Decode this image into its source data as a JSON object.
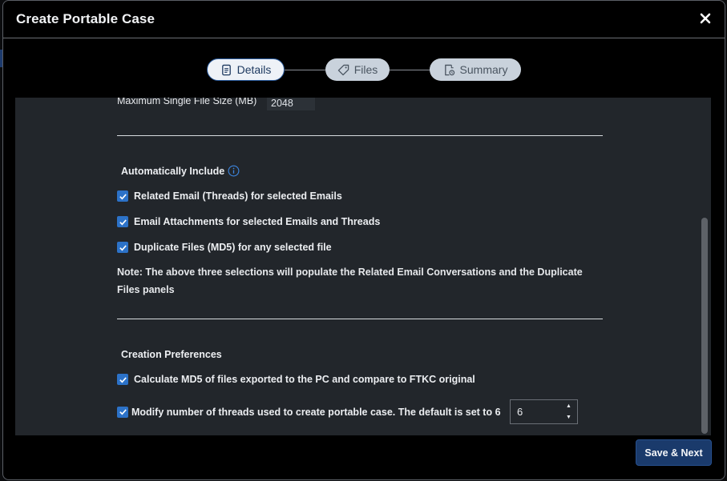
{
  "dialog": {
    "title": "Create Portable Case",
    "close_icon": "close-icon"
  },
  "stepper": {
    "steps": [
      {
        "label": "Details",
        "icon": "document-icon",
        "active": true
      },
      {
        "label": "Files",
        "icon": "tag-icon",
        "active": false
      },
      {
        "label": "Summary",
        "icon": "summary-document-icon",
        "active": false
      }
    ]
  },
  "file_size": {
    "label": "Maximum Single File Size (MB)",
    "value": "2048"
  },
  "auto_include": {
    "title": "Automatically Include",
    "info_icon": "info-icon",
    "options": [
      {
        "label": "Related Email (Threads) for selected Emails",
        "checked": true
      },
      {
        "label": "Email Attachments for selected Emails and Threads",
        "checked": true
      },
      {
        "label": "Duplicate Files (MD5) for any selected file",
        "checked": true
      }
    ],
    "note": "Note: The above three selections will populate the Related Email Conversations and the Duplicate Files panels"
  },
  "creation_prefs": {
    "title": "Creation Preferences",
    "md5_label": "Calculate MD5 of files exported to the PC and compare to FTKC original",
    "md5_checked": true,
    "threads_label": "Modify number of threads used to create portable case. The default is set to 6",
    "threads_checked": true,
    "threads_value": "6"
  },
  "footer": {
    "save_label": "Save & Next"
  },
  "colors": {
    "accent": "#2c72c8",
    "primary_button": "#1a3a6b",
    "panel": "#22262b"
  }
}
